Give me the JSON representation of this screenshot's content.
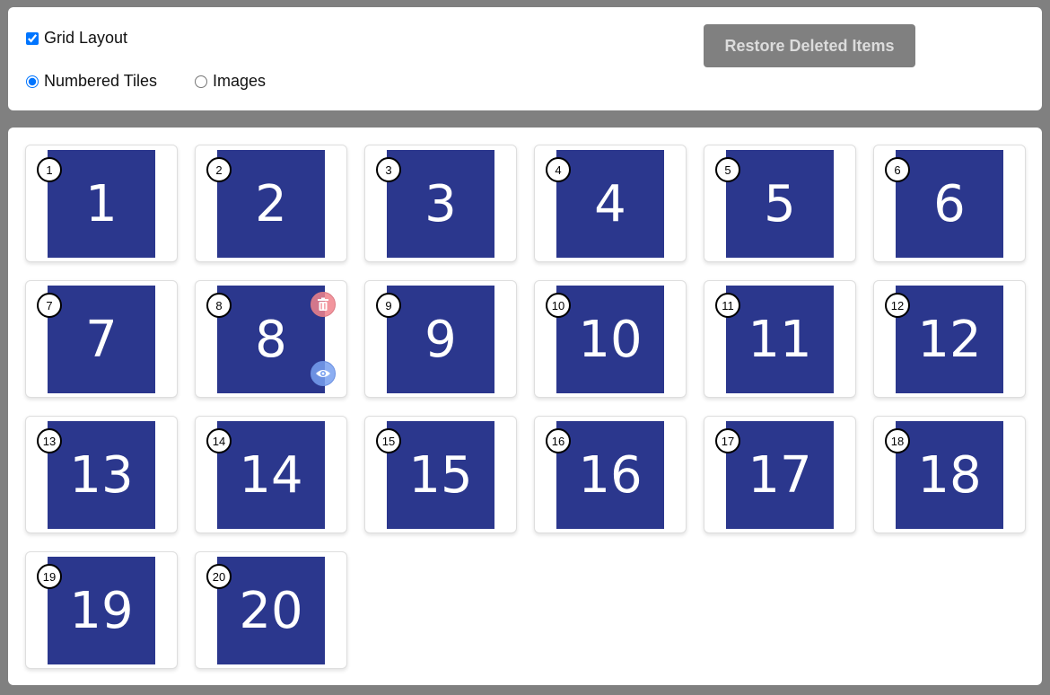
{
  "controls": {
    "grid_layout": {
      "label": "Grid Layout",
      "checked": true
    },
    "mode_numbered": {
      "label": "Numbered Tiles",
      "checked": true
    },
    "mode_images": {
      "label": "Images",
      "checked": false
    },
    "restore_button": "Restore Deleted Items"
  },
  "tiles": [
    "1",
    "2",
    "3",
    "4",
    "5",
    "6",
    "7",
    "8",
    "9",
    "10",
    "11",
    "12",
    "13",
    "14",
    "15",
    "16",
    "17",
    "18",
    "19",
    "20"
  ],
  "hovered_tile": "8",
  "hover_actions": [
    "trash-icon",
    "eye-icon"
  ],
  "colors": {
    "tile_bg": "#2b378d",
    "delete_action": "#f0828c",
    "view_action": "#78a0f0",
    "restore_button": "#808080"
  }
}
